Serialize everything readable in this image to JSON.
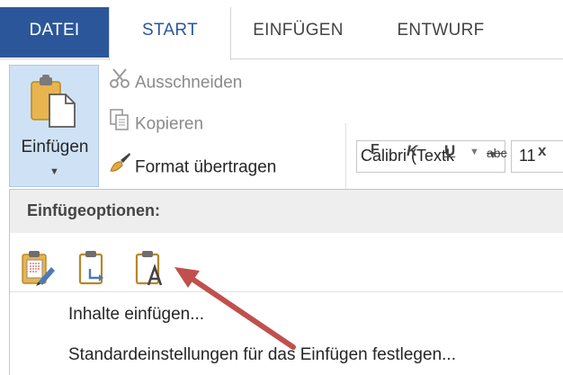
{
  "tabs": {
    "file": "DATEI",
    "start": "START",
    "insert": "EINFÜGEN",
    "design": "ENTWURF"
  },
  "clipboard": {
    "paste_label": "Einfügen",
    "cut_label": "Ausschneiden",
    "copy_label": "Kopieren",
    "format_painter_label": "Format übertragen"
  },
  "font": {
    "name": "Calibri (Textk",
    "size": "11"
  },
  "formatting": {
    "bold": "F",
    "italic": "K",
    "underline": "U",
    "strikethrough": "abc",
    "subscript": "x"
  },
  "paste_menu": {
    "header": "Einfügeoptionen:",
    "options": [
      "keep-source-formatting-icon",
      "merge-formatting-icon",
      "keep-text-only-icon"
    ],
    "items": [
      "Inhalte einfügen...",
      "Standardeinstellungen für das Einfügen festlegen..."
    ]
  },
  "colors": {
    "file_tab": "#2b579a",
    "accent_text": "#2b579a",
    "paste_button_bg": "#cfe2f5",
    "arrow": "#c0504d"
  }
}
